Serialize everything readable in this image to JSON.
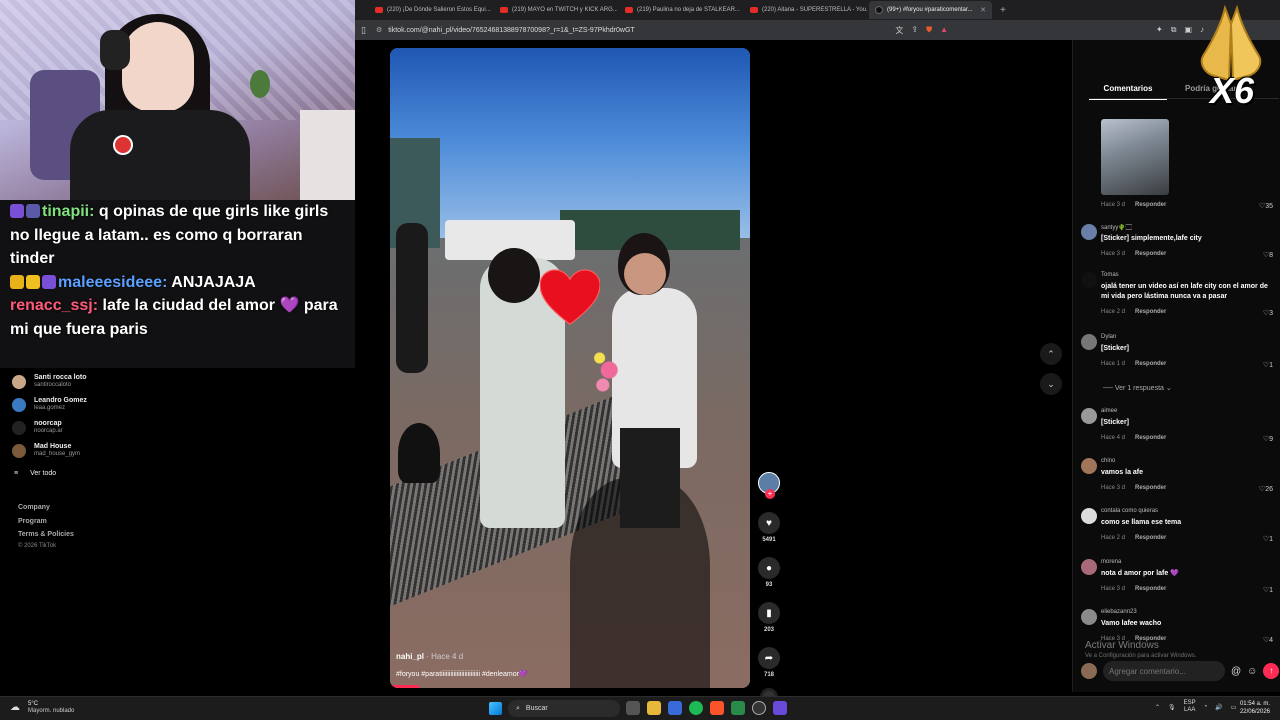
{
  "browser": {
    "tabs": [
      {
        "label": "(220) ¡De Dónde Salieron Estos Equi...",
        "kind": "yt",
        "active": false
      },
      {
        "label": "(219) MAYO en TWITCH y KICK ARG...",
        "kind": "yt",
        "active": false
      },
      {
        "label": "(219) Paulina no deja de STALKEAR...",
        "kind": "yt",
        "active": false
      },
      {
        "label": "(220) Aitana - SUPERESTRELLA - You...",
        "kind": "yt",
        "active": false
      },
      {
        "label": "(99+) #foryou #paraticomentar...",
        "kind": "tt",
        "active": true
      }
    ],
    "new_tab": "+",
    "url": "tiktok.com/@nahi_pl/video/7652468138897870098?_r=1&_t=ZS-97Pkhdr0wGT"
  },
  "stream_chat": [
    {
      "user": "tinapii:",
      "user_color": "#7fe27f",
      "message": " q opinas de que girls like girls no llegue a latam.. es como q borraran tinder",
      "badges": [
        "#7a4fd8",
        "#5a5aa8"
      ]
    },
    {
      "user": "maleeesideee:",
      "user_color": "#5aa0ff",
      "message": " ANJAJAJA",
      "badges": [
        "#e8b21a",
        "#f0c020",
        "#7a4fd8"
      ]
    },
    {
      "user": "renacc_ssj:",
      "user_color": "#ff5a7a",
      "message": " lafe la ciudad del amor 💜 para mi que fuera paris",
      "badges": []
    }
  ],
  "sidebar": {
    "following_accounts": [
      {
        "name": "Santi rocca loto",
        "handle": "santiroccaloto"
      },
      {
        "name": "Leandro Gomez",
        "handle": "leaa.gomez"
      },
      {
        "name": "noorcap",
        "handle": "noorcap.ar"
      },
      {
        "name": "Mad House",
        "handle": "mad_house_gym"
      }
    ],
    "see_all": "Ver todo",
    "footer": [
      "Company",
      "Program",
      "Terms & Policies"
    ],
    "copyright": "© 2026 TikTok"
  },
  "video": {
    "author": "nahi_pl",
    "time": " · Hace 4 d",
    "tags": "#foryou #paratiiiiiiiiiiiiiiiiiiiiiiiii #denleamor💜",
    "likes": "5491",
    "comments": "93",
    "saves": "203",
    "shares": "718",
    "progress_fraction": 0.08
  },
  "comments_panel": {
    "tabs": [
      "Comentarios",
      "Podría gustarte"
    ],
    "reply_label": "Responder",
    "items": [
      {
        "user": "",
        "text": "",
        "time": "Hace 3 d",
        "likes": "35",
        "avatar": "",
        "sticker": true
      },
      {
        "user": "santyy🌵🏻",
        "text": "[Sticker] simplemente,lafe city",
        "time": "Hace 3 d",
        "likes": "8",
        "avatar": "#6a7fa8"
      },
      {
        "user": "Tomas",
        "text": "ojalá tener un video así en lafe city con el amor de mi vida pero lástima nunca va a pasar",
        "time": "Hace 2 d",
        "likes": "3",
        "avatar": "#111"
      },
      {
        "user": "Dylan",
        "text": "[Sticker]",
        "time": "Hace 1 d",
        "likes": "1",
        "avatar": "#777"
      },
      {
        "user": "aimee",
        "text": "[Sticker]",
        "time": "Hace 4 d",
        "likes": "9",
        "avatar": "#999"
      },
      {
        "user": "chino",
        "text": "vamos la afe",
        "time": "Hace 3 d",
        "likes": "26",
        "avatar": "#a0765a"
      },
      {
        "user": "contala como quieras",
        "text": "como se llama ese tema",
        "time": "Hace 2 d",
        "likes": "1",
        "avatar": "#ddd"
      },
      {
        "user": "morena",
        "text": "nota d amor por lafe 💜",
        "time": "Hace 3 d",
        "likes": "1",
        "avatar": "#a86a7a"
      },
      {
        "user": "eliebazann23",
        "text": "Vamo lafee wacho",
        "time": "Hace 3 d",
        "likes": "4",
        "avatar": "#8a8a8a"
      }
    ],
    "see_replies": "Ver 1 respuesta",
    "activate_title": "Activar Windows",
    "activate_sub": "Ve a Configuración para activar Windows.",
    "input_placeholder": "Agregar comentario..."
  },
  "overlay": {
    "multiplier": "X6"
  },
  "taskbar": {
    "weather_temp": "5°C",
    "weather_desc": "Mayorm. nublado",
    "search_placeholder": "Buscar",
    "lang_top": "ESP",
    "lang_bottom": "LAA",
    "time": "01:54 a. m.",
    "date": "22/06/2026"
  }
}
